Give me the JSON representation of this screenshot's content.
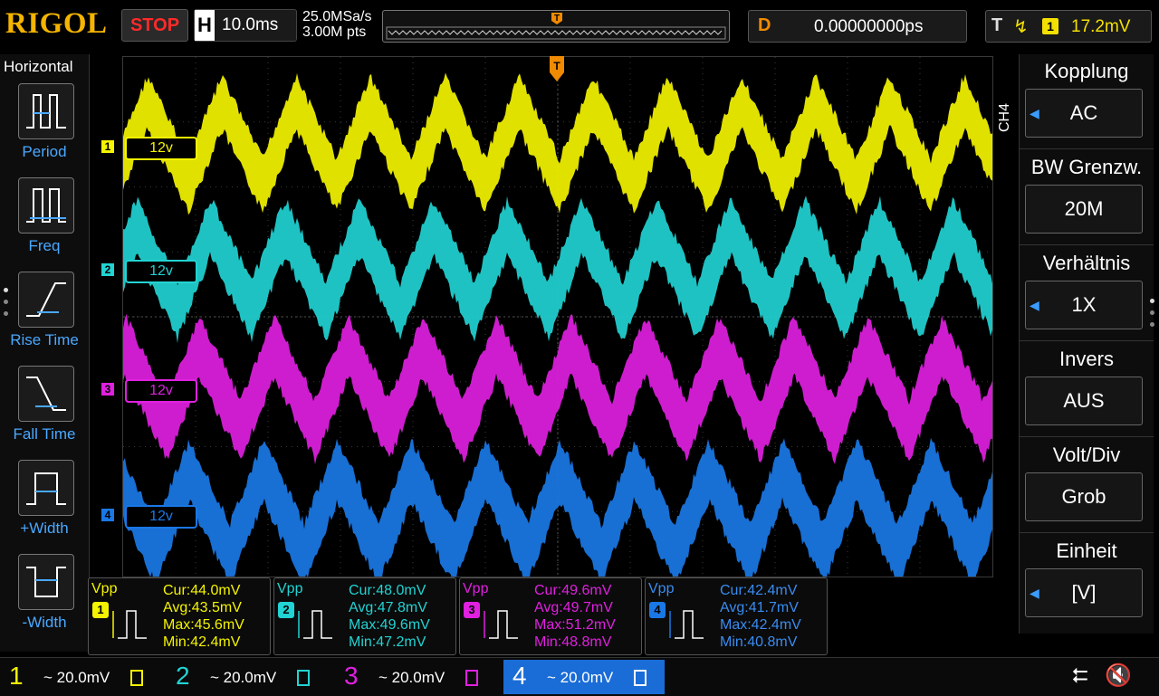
{
  "header": {
    "logo": "RIGOL",
    "run_state": "STOP",
    "h_label": "H",
    "timebase": "10.0ms",
    "sample_rate": "25.0MSa/s",
    "memory_depth": "3.00M pts",
    "trigger_pos_marker": "T",
    "delay_label": "D",
    "delay_value": "0.00000000ps",
    "trig_label": "T",
    "trig_edge": "rising-edge-icon",
    "trig_source": "1",
    "trig_level": "17.2mV"
  },
  "left_menu": {
    "title": "Horizontal",
    "items": [
      {
        "label": "Period",
        "icon": "period-icon"
      },
      {
        "label": "Freq",
        "icon": "freq-icon"
      },
      {
        "label": "Rise Time",
        "icon": "rise-time-icon"
      },
      {
        "label": "Fall Time",
        "icon": "fall-time-icon"
      },
      {
        "label": "+Width",
        "icon": "pos-width-icon"
      },
      {
        "label": "-Width",
        "icon": "neg-width-icon"
      }
    ]
  },
  "channels": [
    {
      "num": "1",
      "label": "12v",
      "color": "#f4f400"
    },
    {
      "num": "2",
      "label": "12v",
      "color": "#22d3d3"
    },
    {
      "num": "3",
      "label": "12v",
      "color": "#e020e0"
    },
    {
      "num": "4",
      "label": "12v",
      "color": "#1a78e6"
    }
  ],
  "right_menu": {
    "channel_tag": "CH4",
    "sections": [
      {
        "title": "Kopplung",
        "value": "AC",
        "arrow": true
      },
      {
        "title": "BW Grenzw.",
        "value": "20M",
        "arrow": false
      },
      {
        "title": "Verhältnis",
        "value": "1X",
        "arrow": true
      },
      {
        "title": "Invers",
        "value": "AUS",
        "arrow": false
      },
      {
        "title": "Volt/Div",
        "value": "Grob",
        "arrow": false
      },
      {
        "title": "Einheit",
        "value": "[V]",
        "arrow": true
      }
    ]
  },
  "measurements": [
    {
      "name": "Vpp",
      "ch": "1",
      "color": "#f4f400",
      "cur": "Cur:44.0mV",
      "avg": "Avg:43.5mV",
      "max": "Max:45.6mV",
      "min": "Min:42.4mV"
    },
    {
      "name": "Vpp",
      "ch": "2",
      "color": "#22d3d3",
      "cur": "Cur:48.0mV",
      "avg": "Avg:47.8mV",
      "max": "Max:49.6mV",
      "min": "Min:47.2mV"
    },
    {
      "name": "Vpp",
      "ch": "3",
      "color": "#e020e0",
      "cur": "Cur:49.6mV",
      "avg": "Avg:49.7mV",
      "max": "Max:51.2mV",
      "min": "Min:48.8mV"
    },
    {
      "name": "Vpp",
      "ch": "4",
      "color": "#1a78e6",
      "cur": "Cur:42.4mV",
      "avg": "Avg:41.7mV",
      "max": "Max:42.4mV",
      "min": "Min:40.8mV"
    }
  ],
  "bottom_bar": [
    {
      "num": "1",
      "scale": "~ 20.0mV",
      "color": "#f4f400",
      "active": false
    },
    {
      "num": "2",
      "scale": "~ 20.0mV",
      "color": "#22d3d3",
      "active": false
    },
    {
      "num": "3",
      "scale": "~ 20.0mV",
      "color": "#e020e0",
      "active": false
    },
    {
      "num": "4",
      "scale": "~ 20.0mV",
      "color": "#ffffff",
      "active": true
    }
  ],
  "status_icons": {
    "usb": "usb-icon",
    "sound": "speaker-muted-icon"
  }
}
